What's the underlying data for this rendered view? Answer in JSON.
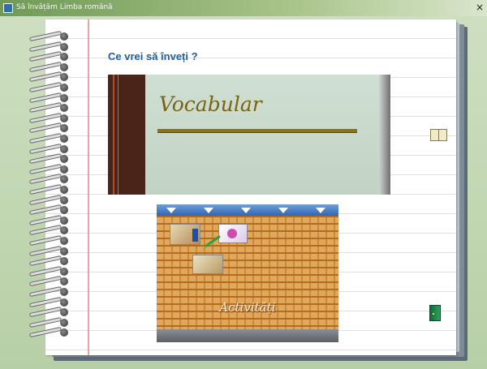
{
  "window": {
    "title": "Să învățăm Limba română",
    "close_label": "×"
  },
  "page": {
    "question": "Ce vrei să înveți ?"
  },
  "vocab_slide": {
    "title": "Vocabular"
  },
  "activities_image": {
    "label": "Activități"
  },
  "icons": {
    "book": "open-book-icon",
    "exit": "green-door-icon",
    "spiral": "spiral-binding"
  }
}
